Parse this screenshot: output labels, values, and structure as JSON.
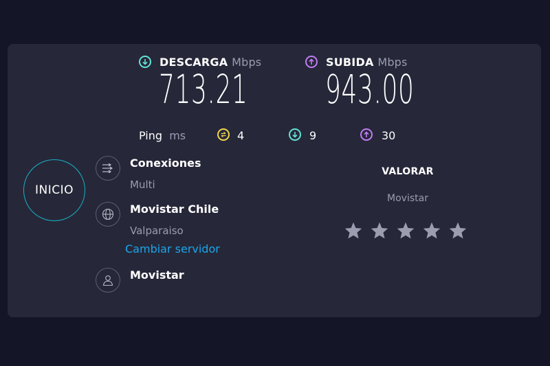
{
  "download": {
    "label": "DESCARGA",
    "unit": "Mbps",
    "value": "713.21",
    "icon": "arrow-down-circle-icon",
    "color": "#63e3d6"
  },
  "upload": {
    "label": "SUBIDA",
    "unit": "Mbps",
    "value": "943.00",
    "icon": "arrow-up-circle-icon",
    "color": "#c27cf4"
  },
  "ping": {
    "label": "Ping",
    "unit": "ms",
    "idle": "4",
    "download": "9",
    "upload": "30",
    "idle_color": "#f3d64b"
  },
  "go_button": {
    "label": "INICIO"
  },
  "connections": {
    "title": "Conexiones",
    "value": "Multi"
  },
  "server": {
    "title": "Movistar Chile",
    "location": "Valparaiso",
    "change_link": "Cambiar servidor"
  },
  "provider": {
    "title": "Movistar"
  },
  "rating": {
    "title": "VALORAR",
    "provider": "Movistar",
    "stars_total": 5,
    "stars_selected": 0
  }
}
